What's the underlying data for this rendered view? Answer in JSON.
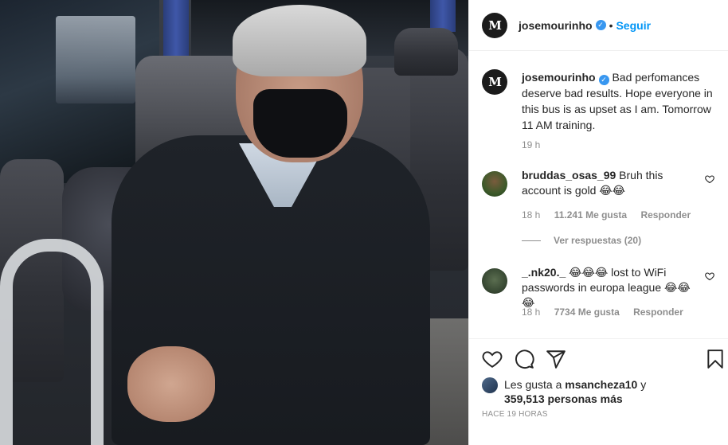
{
  "post": {
    "username": "josemourinho",
    "follow_label": "Seguir",
    "dot": "•",
    "avatar_text": "M"
  },
  "caption": {
    "username": "josemourinho",
    "text": " Bad perfomances deserve bad results. Hope everyone in this bus is as upset as I am. Tomorrow 11 AM training.",
    "time": "19 h"
  },
  "comments": [
    {
      "username": "bruddas_osas_99",
      "text": " Bruh this account is gold 😂😂",
      "time": "18 h",
      "likes": "11.241 Me gusta",
      "reply": "Responder",
      "view_replies": "Ver respuestas (20)"
    },
    {
      "username": "_.nk20._",
      "text": " 😂😂😂 lost to WiFi passwords in europa league 😂😂😂",
      "time": "18 h",
      "likes": "7734 Me gusta",
      "reply": "Responder"
    }
  ],
  "likes_summary": {
    "prefix": "Les gusta a ",
    "user": "msancheza10",
    "suffix": " y ",
    "count": "359,513 personas más"
  },
  "time_ago": "HACE 19 HORAS",
  "icons": [
    "heart-icon",
    "comment-icon",
    "share-icon",
    "bookmark-icon",
    "verified-badge-icon"
  ],
  "colors": {
    "link_blue": "#0095f6",
    "verified_blue": "#3897f0",
    "muted": "#8e8e8e"
  }
}
